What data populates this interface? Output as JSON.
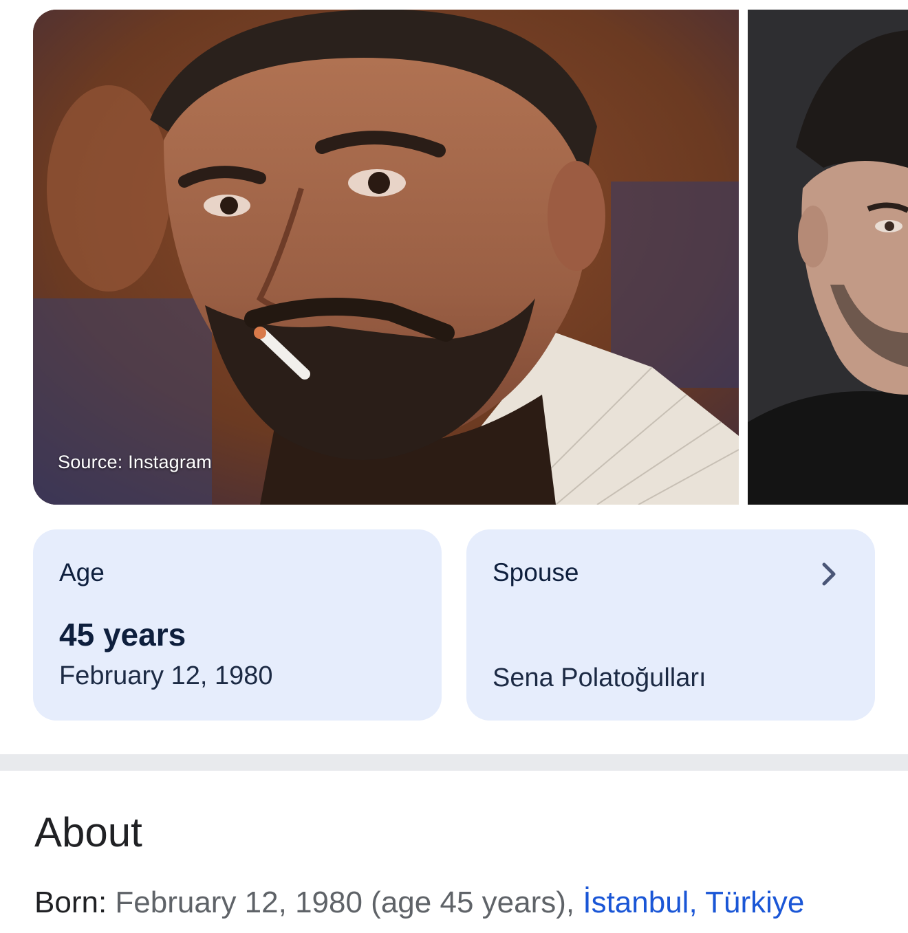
{
  "photos": {
    "main_caption": "Source: Instagram"
  },
  "cards": {
    "age": {
      "label": "Age",
      "value": "45 years",
      "sub": "February 12, 1980"
    },
    "spouse": {
      "label": "Spouse",
      "value": "Sena Polatoğulları",
      "chevron_icon": "chevron-right-icon"
    }
  },
  "about": {
    "title": "About",
    "born_label": "Born:",
    "born_text": " February 12, 1980 (age 45 years), ",
    "born_place": "İstanbul, Türkiye"
  },
  "colors": {
    "card_bg": "#e6edfc",
    "link": "#1a56d6",
    "text_dark": "#202124",
    "text_muted": "#5f6368"
  }
}
